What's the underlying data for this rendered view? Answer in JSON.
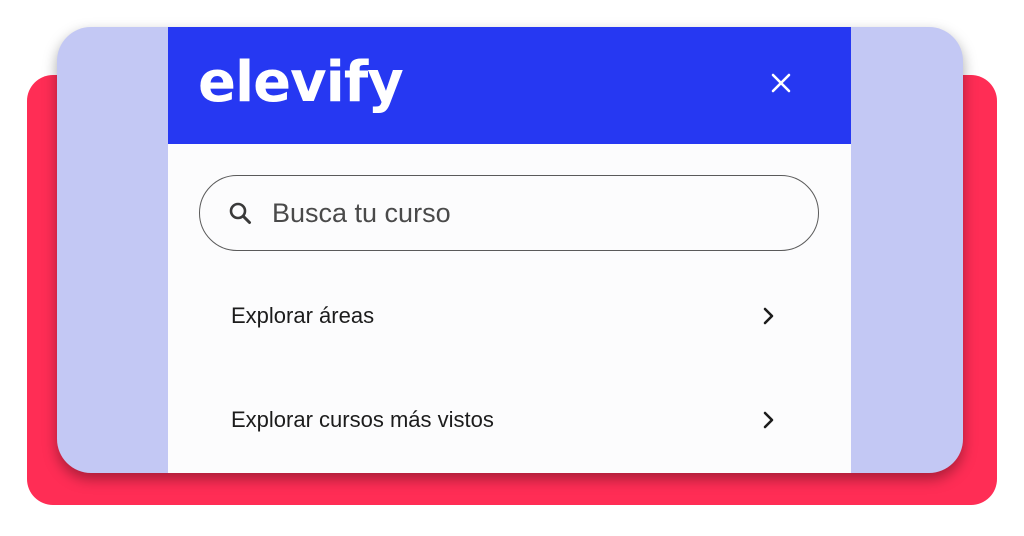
{
  "brand": {
    "logo_text": "elevify",
    "header_color": "#2638f2",
    "back_card_color": "#ff2d55",
    "front_card_color": "#c3c8f4"
  },
  "header": {
    "close_icon": "close-icon"
  },
  "search": {
    "placeholder": "Busca tu curso",
    "icon": "search-icon"
  },
  "menu": {
    "items": [
      {
        "label": "Explorar áreas",
        "icon": "chevron-right-icon"
      },
      {
        "label": "Explorar cursos más vistos",
        "icon": "chevron-right-icon"
      }
    ]
  }
}
